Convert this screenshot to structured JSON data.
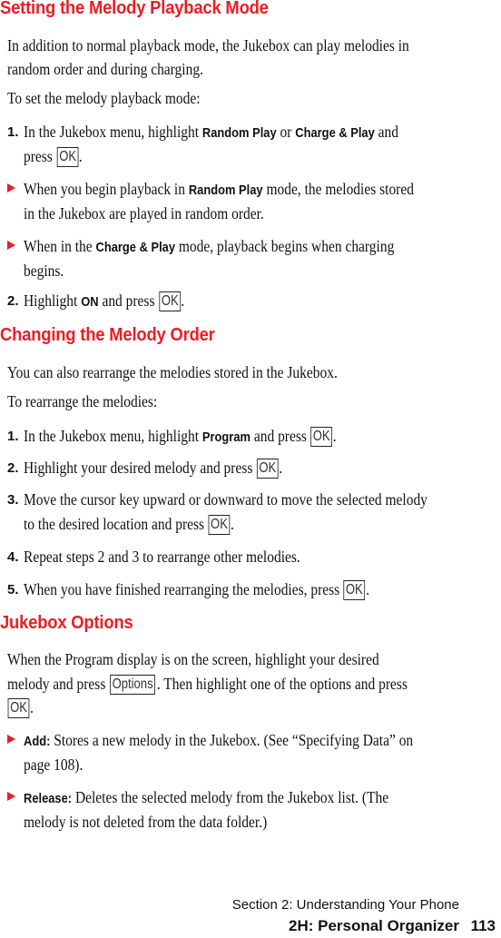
{
  "section1": {
    "title": "Setting the Melody Playback Mode",
    "intro_line1": "In addition to normal playback mode, the Jukebox can play melodies in",
    "intro_line2": "random order and during charging.",
    "lead": "To set the melody playback mode:",
    "step1": {
      "num": "1.",
      "pre": "In the Jukebox menu, highlight ",
      "b1": "Random Play",
      "mid": " or ",
      "b2": "Charge & Play",
      "post": " and",
      "line2_pre": "press ",
      "key": "OK",
      "line2_post": "."
    },
    "bullet1": {
      "pre": "When you begin playback in ",
      "b": "Random Play",
      "post": " mode, the melodies stored",
      "line2": "in the Jukebox are played in random order."
    },
    "bullet2": {
      "pre": "When in the ",
      "b": "Charge & Play",
      "post": " mode, playback begins when charging",
      "line2": "begins."
    },
    "step2": {
      "num": "2.",
      "pre": "Highlight ",
      "b": "ON",
      "post": " and press ",
      "key": "OK",
      "end": "."
    }
  },
  "section2": {
    "title": "Changing the Melody Order",
    "intro": "You can also rearrange the melodies stored in the Jukebox.",
    "lead": "To rearrange the melodies:",
    "step1": {
      "num": "1.",
      "pre": "In the Jukebox menu, highlight ",
      "b": "Program",
      "post": " and press ",
      "key": "OK",
      "end": "."
    },
    "step2": {
      "num": "2.",
      "pre": "Highlight your desired melody and press ",
      "key": "OK",
      "end": "."
    },
    "step3": {
      "num": "3.",
      "line1": "Move the cursor key upward or downward to move the selected melody",
      "line2_pre": "to the desired location and press ",
      "key": "OK",
      "end": "."
    },
    "step4": {
      "num": "4.",
      "text": "Repeat steps 2 and 3 to rearrange other melodies."
    },
    "step5": {
      "num": "5.",
      "pre": "When you have finished rearranging the melodies, press ",
      "key": "OK",
      "end": "."
    }
  },
  "section3": {
    "title": "Jukebox Options",
    "line1": "When the Program display is on the screen, highlight your desired",
    "line2_pre": "melody and press ",
    "options_key": "Options",
    "line2_post": ". Then highlight one of the options and press",
    "line3_key": "OK",
    "line3_end": ".",
    "add": {
      "b": "Add:",
      "text": " Stores a new melody in the Jukebox. (See “Specifying Data” on",
      "line2": "page 108)."
    },
    "release": {
      "b": "Release:",
      "text": " Deletes the selected melody from the Jukebox list. (The",
      "line2": "melody is not deleted from the data folder.)"
    }
  },
  "footer": {
    "section": "Section 2: Understanding Your Phone",
    "chapter": "2H: Personal Organizer",
    "page": "113"
  },
  "colors": {
    "heading": "#ee1c25",
    "bullet": "#ee1c25"
  }
}
